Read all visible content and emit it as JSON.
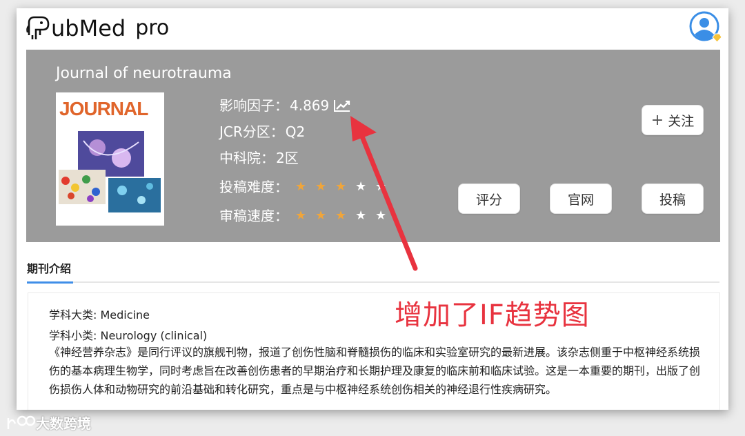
{
  "brand": {
    "name": "ubMed",
    "suffix": "pro"
  },
  "journal": {
    "title": "Journal of neurotrauma",
    "cover_label": "JOURNAL"
  },
  "metrics": {
    "impact_factor_label": "影响因子：",
    "impact_factor_value": "4.869",
    "jcr_label": "JCR分区：",
    "jcr_value": "Q2",
    "cas_label": "中科院：",
    "cas_value": "2区",
    "difficulty_label": "投稿难度：",
    "difficulty_stars": 3,
    "review_speed_label": "审稿速度：",
    "review_speed_stars": 3,
    "stars_total": 5
  },
  "buttons": {
    "follow": "关注",
    "rate": "评分",
    "website": "官网",
    "submit": "投稿"
  },
  "tabs": {
    "intro": "期刊介绍"
  },
  "intro": {
    "category_major": "学科大类: Medicine",
    "category_minor": "学科小类: Neurology (clinical)",
    "description": "《神经营养杂志》是同行评议的旗舰刊物，报道了创伤性脑和脊髓损伤的临床和实验室研究的最新进展。该杂志侧重于中枢神经系统损伤的基本病理生物学，同时考虑旨在改善创伤患者的早期治疗和长期护理及康复的临床前和临床试验。这是一本重要的期刊，出版了创伤损伤人体和动物研究的前沿基础和转化研究，重点是与中枢神经系统创伤相关的神经退行性疾病研究。"
  },
  "annotation": {
    "text": "增加了IF趋势图",
    "color": "#e8333f"
  },
  "watermark": {
    "text": "大数跨境"
  },
  "colors": {
    "banner": "#9b9b9b",
    "star_on": "#f0a53a",
    "tab_accent": "#3f8ee8"
  }
}
